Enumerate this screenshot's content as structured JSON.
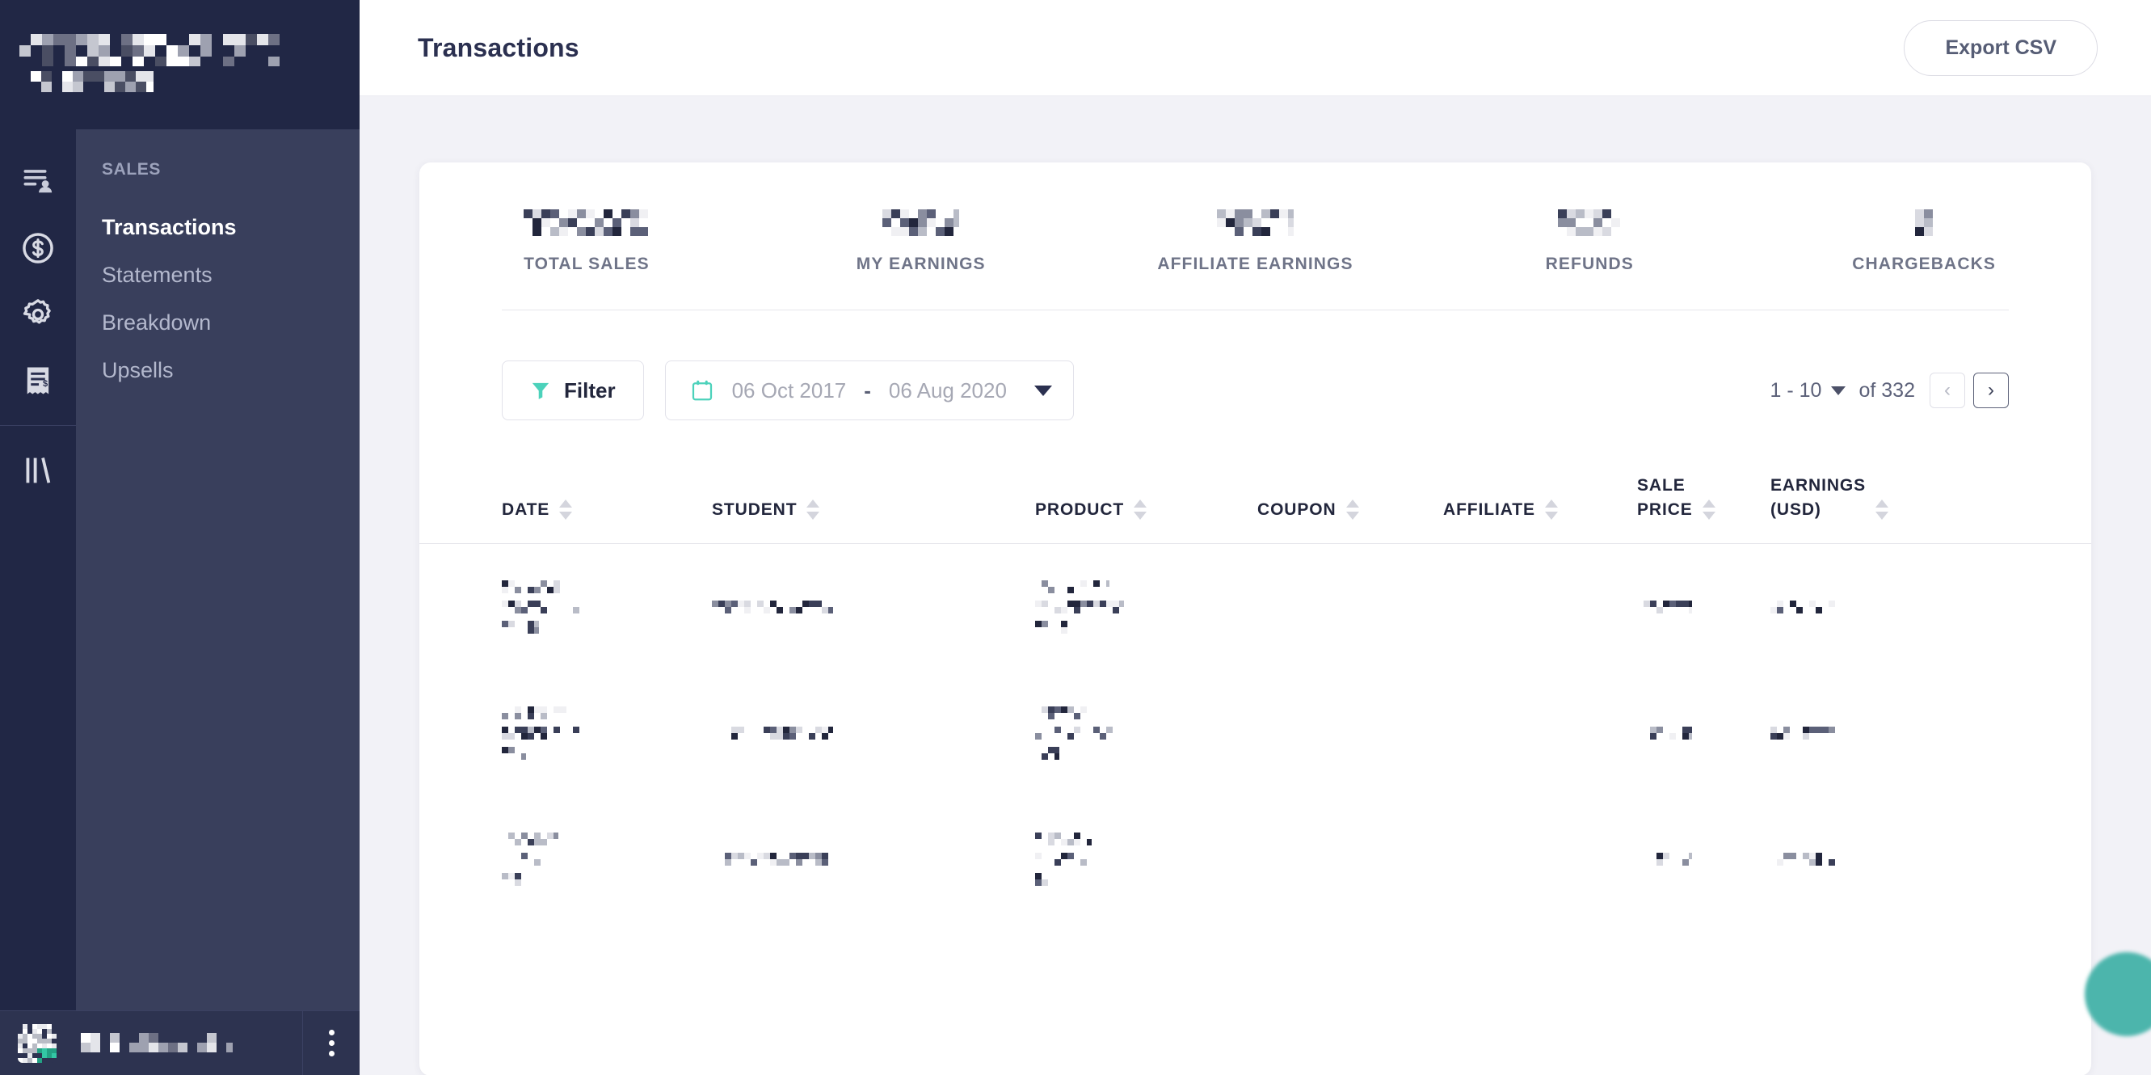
{
  "brand": {
    "line1_redacted": true,
    "line2_redacted": true
  },
  "sidebar": {
    "rail_icons": [
      {
        "name": "students-list-icon"
      },
      {
        "name": "dollar-circle-icon"
      },
      {
        "name": "gear-icon"
      },
      {
        "name": "receipt-icon"
      },
      {
        "name": "library-books-icon"
      }
    ],
    "section_title": "SALES",
    "items": [
      {
        "label": "Transactions",
        "active": true
      },
      {
        "label": "Statements",
        "active": false
      },
      {
        "label": "Breakdown",
        "active": false
      },
      {
        "label": "Upsells",
        "active": false
      }
    ],
    "user": {
      "name_redacted": true,
      "menu_icon": "kebab-menu-icon"
    }
  },
  "header": {
    "title": "Transactions",
    "export_label": "Export CSV"
  },
  "kpis": [
    {
      "label": "TOTAL SALES",
      "value_redacted": true,
      "value_width": 155
    },
    {
      "label": "MY EARNINGS",
      "value_redacted": true,
      "value_width": 95
    },
    {
      "label": "AFFILIATE EARNINGS",
      "value_redacted": true,
      "value_width": 95
    },
    {
      "label": "REFUNDS",
      "value_redacted": true,
      "value_width": 78
    },
    {
      "label": "CHARGEBACKS",
      "value_redacted": true,
      "value_width": 22
    }
  ],
  "toolbar": {
    "filter_label": "Filter",
    "filter_icon": "funnel-icon",
    "calendar_icon": "calendar-icon",
    "date_start": "06 Oct 2017",
    "date_separator": "-",
    "date_end": "06 Aug 2020",
    "dropdown_icon": "chevron-down-icon"
  },
  "pagination": {
    "range": "1 - 10",
    "of_label": "of",
    "total": "332",
    "prev_icon": "chevron-left-icon",
    "prev_glyph": "‹",
    "next_icon": "chevron-right-icon",
    "next_glyph": "›",
    "prev_enabled": false,
    "next_enabled": true
  },
  "table": {
    "columns": [
      {
        "key": "date",
        "label": "DATE",
        "label2": "",
        "sortable": true
      },
      {
        "key": "student",
        "label": "STUDENT",
        "label2": "",
        "sortable": true
      },
      {
        "key": "product",
        "label": "PRODUCT",
        "label2": "",
        "sortable": true
      },
      {
        "key": "coupon",
        "label": "COUPON",
        "label2": "",
        "sortable": true
      },
      {
        "key": "affiliate",
        "label": "AFFILIATE",
        "label2": "",
        "sortable": true
      },
      {
        "key": "sale",
        "label": "SALE",
        "label2": "PRICE",
        "sortable": true
      },
      {
        "key": "earnings",
        "label": "EARNINGS",
        "label2": "(USD)",
        "sortable": true
      }
    ],
    "rows": [
      {
        "date_redacted": true,
        "student_redacted": true,
        "product_redacted": true,
        "coupon": "",
        "affiliate": "",
        "sale_redacted": true,
        "earnings_redacted": true
      },
      {
        "date_redacted": true,
        "student_redacted": true,
        "product_redacted": true,
        "coupon": "",
        "affiliate": "",
        "sale_redacted": true,
        "earnings_redacted": true
      },
      {
        "date_redacted": true,
        "student_redacted": true,
        "product_redacted": true,
        "coupon": "",
        "affiliate": "",
        "sale_redacted": true,
        "earnings_redacted": true
      }
    ]
  },
  "fab": {
    "name": "help-chat-button"
  },
  "colors": {
    "sidebar_rail": "#212745",
    "sidebar_submenu": "#393f5c",
    "sidebar_userbar": "#2d3350",
    "accent_teal": "#4cd2bb",
    "fab_teal": "#4cb5ac",
    "page_bg": "#f2f2f7",
    "card_bg": "#ffffff",
    "text_dark": "#22263c",
    "text_muted": "#6f7488"
  }
}
